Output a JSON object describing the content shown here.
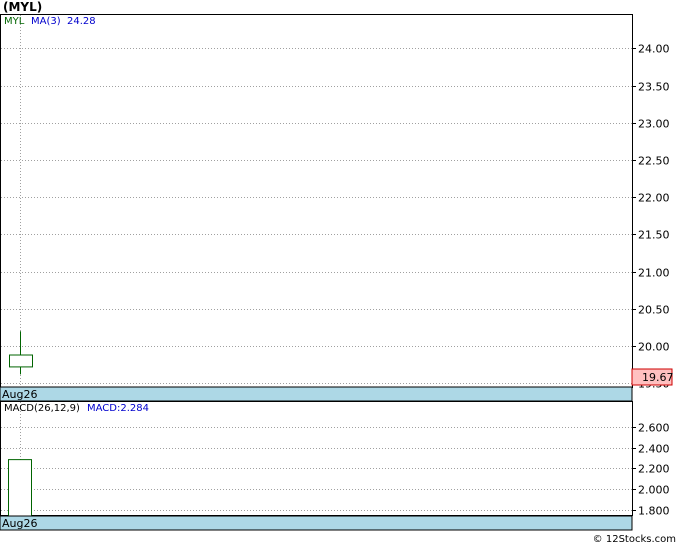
{
  "title": "(MYL)",
  "footer": "© 12Stocks.com",
  "colors": {
    "axis_band": "#add8e6",
    "price_label_bg": "#ffc0c0",
    "candle": "#006400",
    "ma": "#0000cd",
    "grid": "#a0a0a0"
  },
  "chart_data": [
    {
      "type": "candlestick",
      "legend": {
        "symbol": "MYL",
        "ma_label": "MA(3)",
        "ma_value": "24.28"
      },
      "x": [
        "Aug26"
      ],
      "candles": [
        {
          "date": "Aug26",
          "open": 19.72,
          "high": 20.2,
          "low": 19.62,
          "close": 19.88
        }
      ],
      "ylim": [
        19.45,
        24.45
      ],
      "yticks": [
        "24.00",
        "23.50",
        "23.00",
        "22.50",
        "22.00",
        "21.50",
        "21.00",
        "20.50",
        "20.00",
        "19.50"
      ],
      "last_price": "19.67",
      "grid": true
    },
    {
      "type": "bar",
      "legend": {
        "label": "MACD(26,12,9)",
        "value_label": "MACD:2.284"
      },
      "x": [
        "Aug26"
      ],
      "values": [
        2.284
      ],
      "ylim": [
        1.74,
        2.84
      ],
      "yticks": [
        "2.600",
        "2.400",
        "2.200",
        "2.000",
        "1.800"
      ],
      "grid": true
    }
  ]
}
